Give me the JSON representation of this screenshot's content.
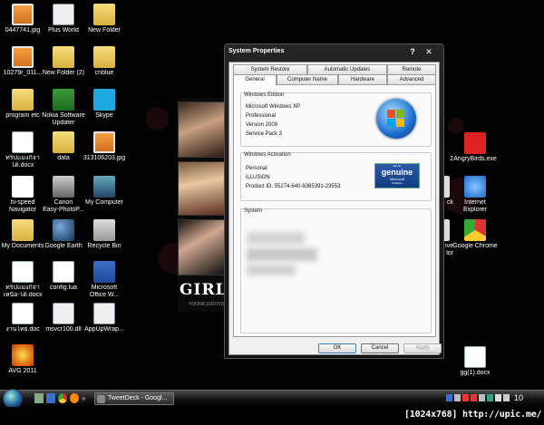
{
  "desktop": {
    "icons": [
      {
        "label": "0447741.jpg",
        "icon": "jpg-image-icon"
      },
      {
        "label": "Plus World",
        "icon": "plus-world-icon"
      },
      {
        "label": "New Folder",
        "icon": "folder-icon"
      },
      {
        "label": "10279r_011...",
        "icon": "jpg-image-icon"
      },
      {
        "label": "New Folder (2)",
        "icon": "folder-icon"
      },
      {
        "label": "cnblue",
        "icon": "folder-icon"
      },
      {
        "label": "program etc",
        "icon": "folder-icon"
      },
      {
        "label": "Nokia Software",
        "label2": "Updater",
        "icon": "nokia-icon"
      },
      {
        "label": "Skype",
        "icon": "skype-icon"
      },
      {
        "label": "ทริปแมงกิจา",
        "label2": "ได้.docx",
        "icon": "document-icon"
      },
      {
        "label": "data",
        "icon": "folder-icon"
      },
      {
        "label": "313106203.jpg",
        "icon": "jpg-image-icon"
      },
      {
        "label": "hi-speed",
        "label2": "Navigator",
        "icon": "truemove-icon"
      },
      {
        "label": "Canon",
        "label2": "Easy-PhotoP...",
        "icon": "scanner-icon"
      },
      {
        "label": "My Computer",
        "icon": "computer-icon"
      },
      {
        "label": "My Documents",
        "icon": "folder-icon"
      },
      {
        "label": "Google Earth",
        "icon": "google-earth-icon"
      },
      {
        "label": "Recycle Bin",
        "icon": "recycle-bin-icon"
      },
      {
        "label": "ทริปแมงกิจา",
        "label2": "เหนือ-ได้.docx",
        "icon": "document-icon"
      },
      {
        "label": "config.lua",
        "icon": "file-icon"
      },
      {
        "label": "Microsoft",
        "label2": "Office W...",
        "icon": "word-icon"
      },
      {
        "label": "งานไทย.doc",
        "icon": "document-icon"
      },
      {
        "label": "msvcr100.dll",
        "icon": "gear-file-icon"
      },
      {
        "label": "AppUpWrap...",
        "icon": "gear-file-icon"
      },
      {
        "label": "AVG 2011",
        "icon": "avg-icon"
      },
      {
        "label": "2",
        "icon": "document-icon"
      },
      {
        "label": "AngryBirds.exe",
        "icon": "angry-birds-icon"
      },
      {
        "label": "ck",
        "icon": "document-icon"
      },
      {
        "label": "Internet",
        "label2": "Explorer",
        "icon": "internet-explorer-icon"
      },
      {
        "label": "ive",
        "label2": "lor",
        "icon": "document-icon"
      },
      {
        "label": "Google Chrome",
        "icon": "chrome-icon"
      },
      {
        "label": "gg(1).docx",
        "icon": "document-icon"
      }
    ],
    "wallpaper": {
      "title": "GIRL",
      "subtitle": "YOONA SOOYOUNG"
    }
  },
  "dialog": {
    "title": "System Properties",
    "help_glyph": "?",
    "close_glyph": "✕",
    "tabs_top": [
      "System Restore",
      "Automatic Updates",
      "Remote"
    ],
    "tabs_bottom": [
      "General",
      "Computer Name",
      "Hardware",
      "Advanced"
    ],
    "active_tab": "General",
    "edition": {
      "heading": "Windows Edition",
      "lines": [
        "Microsoft Windows XP",
        "Professional",
        "Version 2009",
        "Service Pack 3"
      ]
    },
    "activation": {
      "heading": "Windows Activation",
      "lines": [
        "Personal",
        "iLLUSiON",
        "Product ID:    55274-640-8365391-23553"
      ],
      "genuine_top": "ask for",
      "genuine_big": "genuine",
      "genuine_brand": "Microsoft",
      "genuine_sub": "Software"
    },
    "system": {
      "heading": "System"
    },
    "buttons": {
      "ok": "OK",
      "cancel": "Cancel",
      "apply": "Apply"
    }
  },
  "taskbar": {
    "task_label": "TweetDeck - Googl...",
    "quicklaunch_more": "»",
    "clock": "10"
  },
  "watermark": "[1024x768] http://upic.me/"
}
